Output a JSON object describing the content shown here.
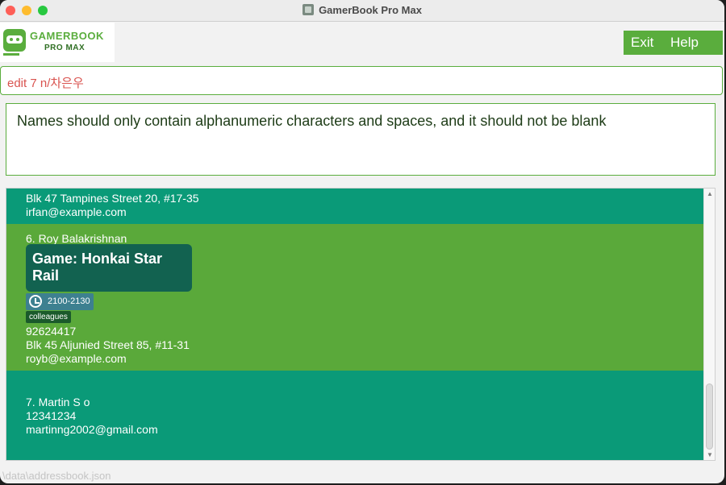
{
  "window": {
    "title": "GamerBook Pro Max"
  },
  "logo": {
    "title": "GAMERBOOK",
    "subtitle": "PRO MAX"
  },
  "menu": {
    "exit": "Exit",
    "help": "Help"
  },
  "command": {
    "value": "edit 7 n/차은우"
  },
  "result": {
    "message": "Names should only contain alphanumeric characters and spaces, and it should not be blank"
  },
  "contacts": {
    "partial": {
      "address": "Blk 47 Tampines Street 20, #17-35",
      "email": "irfan@example.com"
    },
    "roy": {
      "name": "6. Roy Balakrishnan",
      "game": "Game: Honkai Star Rail",
      "time": "2100-2130",
      "tag": "colleagues",
      "phone": "92624417",
      "address": "Blk 45 Aljunied Street 85, #11-31",
      "email": "royb@example.com"
    },
    "martin": {
      "name": "7. Martin S o",
      "phone": "12341234",
      "email": "martinng2002@gmail.com"
    }
  },
  "status": {
    "path": "\\data\\addressbook.json"
  },
  "colors": {
    "accent": "#5aad3d",
    "card_teal": "#0a9a78",
    "card_green": "#5aa93a",
    "game_box": "#126250",
    "error": "#d9534f"
  },
  "icons": [
    "clock-icon",
    "app-icon",
    "gamepad-icon"
  ]
}
